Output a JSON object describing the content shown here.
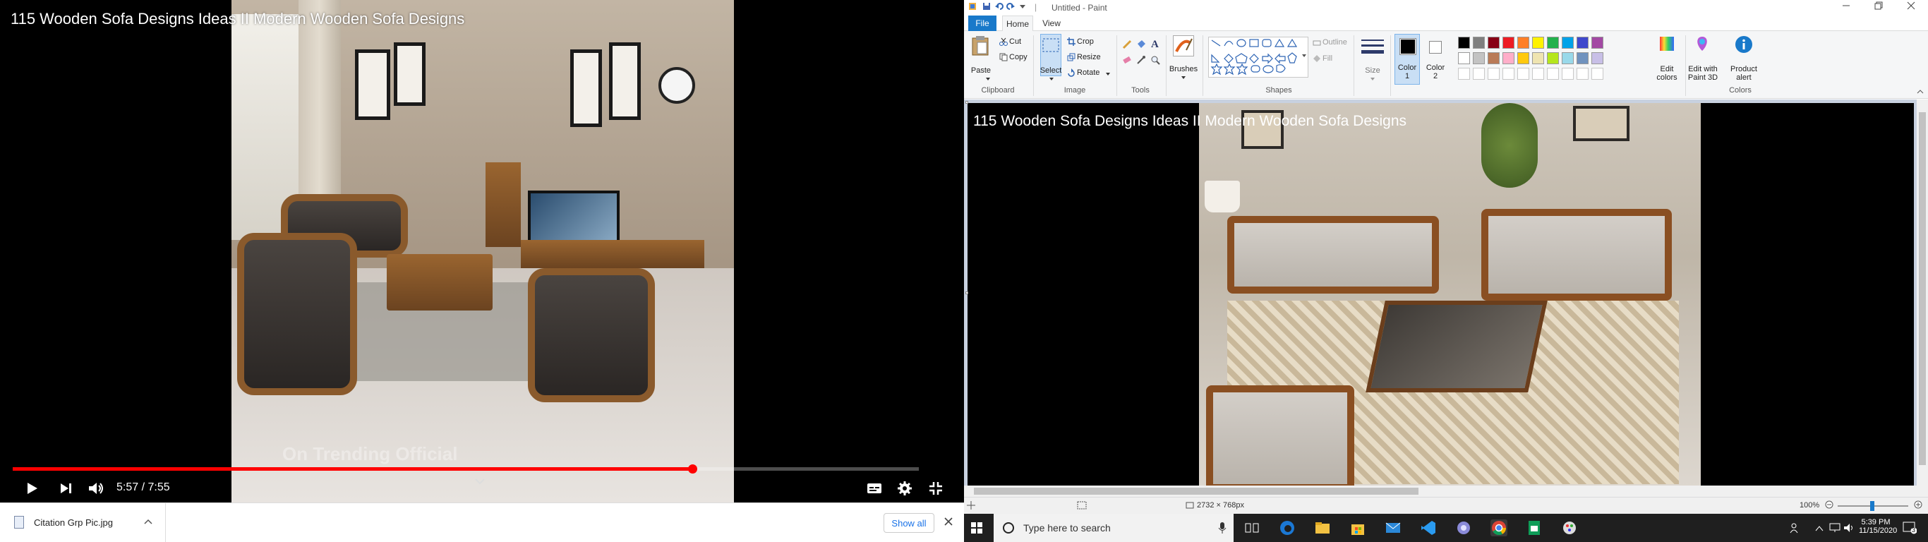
{
  "video": {
    "title": "115 Wooden Sofa Designs Ideas II Modern Wooden Sofa Designs",
    "watermark": "On Trending Official",
    "time": "5:57 / 7:55",
    "progress_fraction": 0.75
  },
  "downloads": {
    "file_name": "Citation Grp Pic.jpg",
    "show_all": "Show all"
  },
  "paint": {
    "window_title": "Untitled - Paint",
    "tabs": {
      "file": "File",
      "home": "Home",
      "view": "View"
    },
    "clipboard": {
      "paste": "Paste",
      "cut": "Cut",
      "copy": "Copy",
      "label": "Clipboard"
    },
    "image": {
      "select": "Select",
      "crop": "Crop",
      "resize": "Resize",
      "rotate": "Rotate",
      "label": "Image"
    },
    "tools": {
      "label": "Tools"
    },
    "brushes": "Brushes",
    "shapes": {
      "outline": "Outline",
      "fill": "Fill",
      "label": "Shapes"
    },
    "size": "Size",
    "color1": [
      "Color",
      "1"
    ],
    "color2": [
      "Color",
      "2"
    ],
    "colors_label": "Colors",
    "edit_colors": [
      "Edit",
      "colors"
    ],
    "edit_3d": [
      "Edit with",
      "Paint 3D"
    ],
    "product_alert": [
      "Product",
      "alert"
    ],
    "palette_row1": [
      "#000000",
      "#7f7f7f",
      "#880015",
      "#ed1c24",
      "#ff7f27",
      "#fff200",
      "#22b14c",
      "#00a2e8",
      "#3f48cc",
      "#a349a4"
    ],
    "palette_row2": [
      "#ffffff",
      "#c3c3c3",
      "#b97a57",
      "#ffaec9",
      "#ffc90e",
      "#efe4b0",
      "#b5e61d",
      "#99d9ea",
      "#7092be",
      "#c8bfe7"
    ],
    "canvas_title": "115 Wooden Sofa Designs Ideas II Modern Wooden Sofa Designs",
    "status_size": "2732 × 768px",
    "zoom": "100%"
  },
  "taskbar": {
    "search_placeholder": "Type here to search",
    "time": "5:39 PM",
    "date": "11/15/2020",
    "notifications": "3"
  }
}
